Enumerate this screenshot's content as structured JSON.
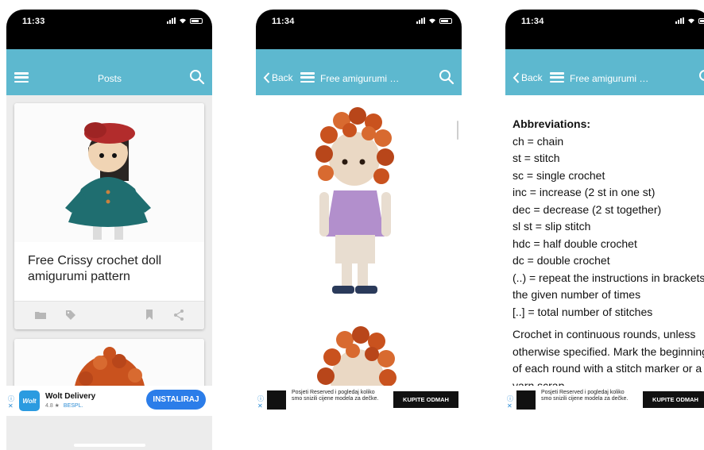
{
  "colors": {
    "navbar": "#5db8cf",
    "ad_button": "#2b7de9",
    "yarn_orange": "#c9521e"
  },
  "screens": [
    {
      "time": "11:33",
      "title": "Posts",
      "card1_title": "Free Crissy crochet doll amigurumi pattern",
      "ad": {
        "name": "Wolt Delivery",
        "rating": "4.8 ★",
        "price": "BESPL.",
        "logo": "Wolt",
        "cta": "INSTALIRAJ"
      }
    },
    {
      "time": "11:34",
      "back": "Back",
      "title": "Free amigurumi …",
      "ad": {
        "text": "Posjeti Reserved i pogledaj koliko smo snizili cijene modela za dečke.",
        "cta": "KUPITE ODMAH"
      }
    },
    {
      "time": "11:34",
      "back": "Back",
      "title": "Free amigurumi …",
      "abbr_heading": "Abbreviations:",
      "abbr": [
        "ch = chain",
        "st = stitch",
        "sc = single crochet",
        "inc = increase (2 st in one st)",
        "dec = decrease (2 st together)",
        "sl st = slip stitch",
        "hdc = half double crochet",
        "dc = double crochet",
        "(..) = repeat the instructions in brackets the given number of times",
        "[..] = total number of stitches"
      ],
      "para": "Crochet in continuous rounds, unless otherwise specified. Mark the beginning of each round with a stitch marker or a yarn scrap.",
      "ad": {
        "text": "Posjeti Reserved i pogledaj koliko smo snizili cijene modela za dečke.",
        "cta": "KUPITE ODMAH"
      }
    }
  ]
}
